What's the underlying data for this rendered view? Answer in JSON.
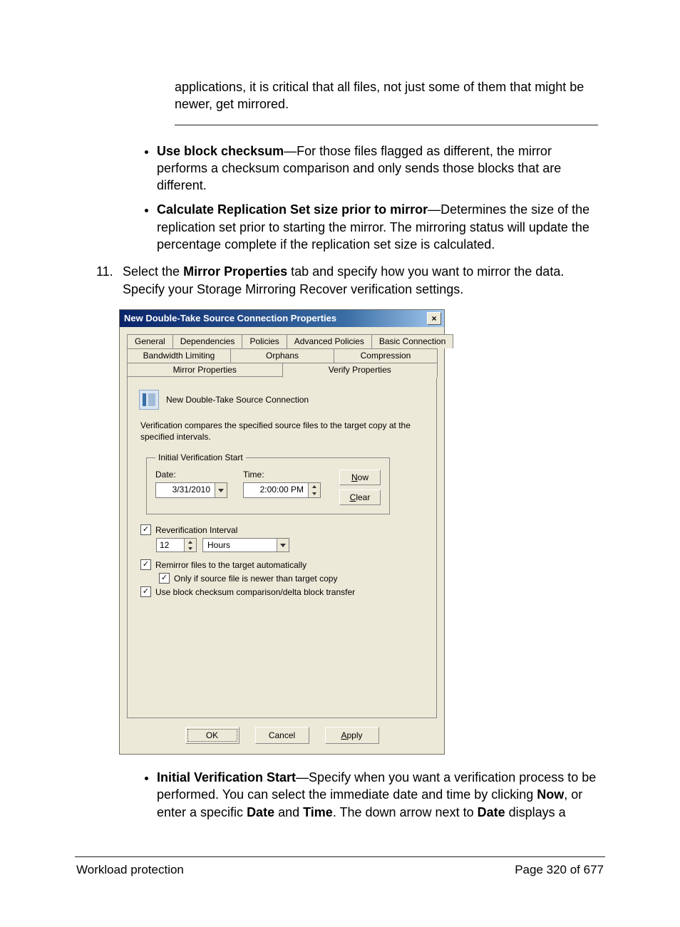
{
  "intro_trailing": "applications, it is critical that all files, not just some of them that might be newer, get mirrored.",
  "bullet_a": {
    "lead": "Use block checksum",
    "rest": "—For those files flagged as different, the mirror performs a checksum comparison and only sends those blocks that are different."
  },
  "bullet_b": {
    "lead": "Calculate Replication Set size prior to mirror",
    "rest": "—Determines the size of the replication set prior to starting the mirror. The mirroring status will update the percentage complete if the replication set size is calculated."
  },
  "step11": {
    "num": "11.",
    "before": "Select the ",
    "bold": "Mirror Properties",
    "after": " tab and specify how you want to mirror the data. Specify your Storage Mirroring Recover  verification settings."
  },
  "dialog": {
    "title": "New Double-Take Source Connection Properties",
    "tabs_row1": [
      "General",
      "Dependencies",
      "Policies",
      "Advanced Policies",
      "Basic Connection"
    ],
    "tabs_row2": [
      "Bandwidth Limiting",
      "Orphans",
      "Compression"
    ],
    "tabs_row3": [
      "Mirror Properties",
      "Verify Properties"
    ],
    "active_tab": "Verify Properties",
    "heading": "New Double-Take Source Connection",
    "desc": "Verification compares the specified source files to the target copy at the specified intervals.",
    "group_legend": "Initial Verification Start",
    "date_label": "Date:",
    "date_value": "3/31/2010",
    "time_label": "Time:",
    "time_value": "2:00:00 PM",
    "now_btn": "Now",
    "clear_btn": "Clear",
    "reverify_label": "Reverification Interval",
    "reverify_value": "12",
    "reverify_unit": "Hours",
    "remirror_label": "Remirror files to the target automatically",
    "onlyif_label": "Only if source file is newer than target copy",
    "blockchk_label": "Use block checksum comparison/delta block transfer",
    "ok": "OK",
    "cancel": "Cancel",
    "apply": "Apply"
  },
  "post_bullet": {
    "lead": "Initial Verification Start",
    "p1a": "—Specify when you want a verification process to be performed. You can select the immediate date and time by clicking ",
    "b1": "Now",
    "p1b": ", or enter a specific ",
    "b2": "Date",
    "p1c": " and ",
    "b3": "Time",
    "p1d": ". The down arrow next to ",
    "b4": "Date",
    "p1e": " displays a"
  },
  "footer_left": "Workload protection",
  "footer_right": "Page 320 of 677"
}
